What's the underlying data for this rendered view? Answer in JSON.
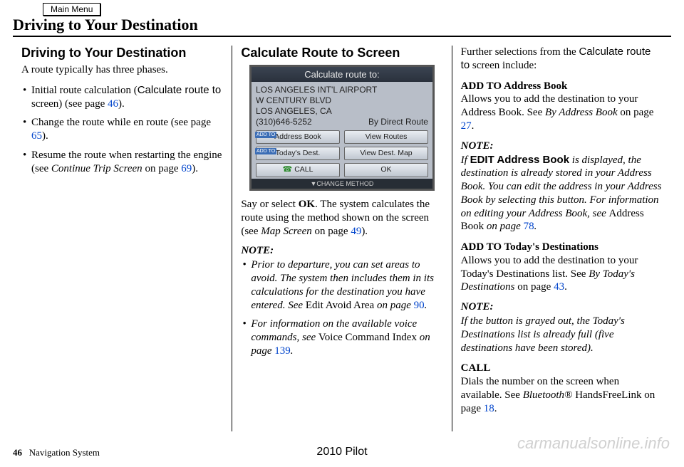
{
  "main_menu": "Main Menu",
  "page_title": "Driving to Your Destination",
  "col1": {
    "h": "Driving to Your Destination",
    "intro": "A route typically has three phases.",
    "b1a": "Initial route calculation (",
    "b1b": "Calculate route to",
    "b1c": " screen) (see page ",
    "b1d": "46",
    "b1e": ").",
    "b2a": "Change the route while en route (see page ",
    "b2b": "65",
    "b2c": ").",
    "b3a": "Resume the route when restarting the engine (see ",
    "b3b": "Continue Trip Screen",
    "b3c": " on page ",
    "b3d": "69",
    "b3e": ")."
  },
  "col2": {
    "h": "Calculate Route to Screen",
    "screen": {
      "title": "Calculate route to:",
      "l1": "LOS ANGELES INT'L AIRPORT",
      "l2": "W CENTURY BLVD",
      "l3": "LOS ANGELES, CA",
      "phone": "(310)646-5252",
      "route_method": "By Direct Route",
      "btn1": "Address Book",
      "btn2": "View Routes",
      "btn3": "Today's Dest.",
      "btn4": "View Dest. Map",
      "call": "CALL",
      "ok": "OK",
      "footer": "▼CHANGE METHOD",
      "tag": "ADD TO"
    },
    "p1a": "Say or select ",
    "p1b": "OK",
    "p1c": ". The system calculates the route using the method shown on the screen (see ",
    "p1d": "Map Screen",
    "p1e": " on page ",
    "p1f": "49",
    "p1g": ").",
    "note_label": "NOTE:",
    "n1a": "Prior to departure, you can set areas to avoid. The system then includes them in its calculations for the destination you have entered. See ",
    "n1b": "Edit Avoid Area",
    "n1c": " on page ",
    "n1d": "90",
    "n1e": ".",
    "n2a": "For information on the available voice commands, see ",
    "n2b": "Voice Command Index",
    "n2c": " on page ",
    "n2d": "139",
    "n2e": "."
  },
  "col3": {
    "intro1": "Further selections from the ",
    "intro2": "Calculate route to",
    "intro3": " screen include:",
    "h1": "ADD TO Address Book",
    "p1a": "Allows you to add the destination to your Address Book. See ",
    "p1b": "By Address Book",
    "p1c": " on page ",
    "p1d": "27",
    "p1e": ".",
    "note1_label": "NOTE:",
    "n1a": "If ",
    "n1b": "EDIT Address Book",
    "n1c": " is displayed, the destination is already stored in your Address Book. You can edit the address in your Address Book by selecting this button. For information on editing your Address Book, see ",
    "n1d": "Address Book",
    "n1e": " on page ",
    "n1f": "78",
    "n1g": ".",
    "h2": "ADD TO Today's Destinations",
    "p2a": "Allows you to add the destination to your Today's Destinations list. See ",
    "p2b": "By Today's Destinations",
    "p2c": " on page ",
    "p2d": "43",
    "p2e": ".",
    "note2_label": "NOTE:",
    "n2": "If the button is grayed out, the Today's Destinations list is already full (five destinations have been stored).",
    "h3": "CALL",
    "p3a": "Dials the number on the screen when available. See ",
    "p3b": "Bluetooth®",
    "p3c": " HandsFreeLink on page ",
    "p3d": "18",
    "p3e": "."
  },
  "footer": {
    "pg_num": "46",
    "system": "Navigation System",
    "model": "2010 Pilot"
  },
  "watermark": "carmanualsonline.info"
}
